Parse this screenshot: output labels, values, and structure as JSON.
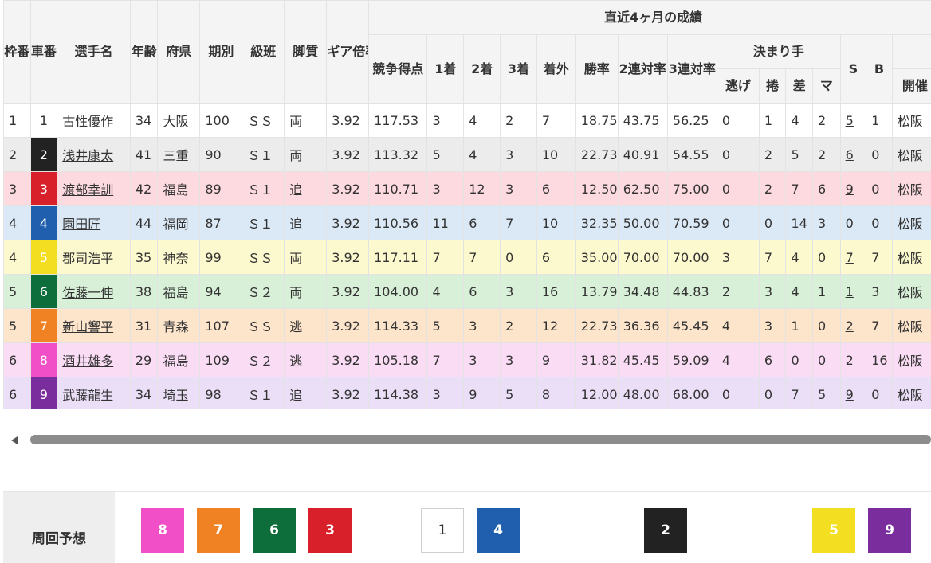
{
  "header": {
    "waku": "枠番",
    "sha": "車番",
    "name": "選手名",
    "age": "年齢",
    "pref": "府県",
    "term": "期別",
    "class": "級班",
    "style": "脚質",
    "gear": "ギア倍率",
    "recent": "直近4ヶ月の成績",
    "score": "競争得点",
    "first": "1着",
    "second": "2着",
    "third": "3着",
    "out": "着外",
    "winrate": "勝率",
    "quinella": "2連対率",
    "trio": "3連対率",
    "kimarite": "決まり手",
    "nige": "逃げ",
    "makuri": "捲",
    "sashi": "差",
    "mark": "マ",
    "s": "S",
    "b": "B",
    "venue": "開催"
  },
  "rows": [
    {
      "waku": "1",
      "car": "1",
      "name": "古性優作",
      "age": "34",
      "pref": "大阪",
      "term": "100",
      "class": "ＳＳ",
      "style": "両",
      "gear": "3.92",
      "score": "117.53",
      "w1": "3",
      "w2": "4",
      "w3": "2",
      "out": "7",
      "winrate": "18.75",
      "quinella": "43.75",
      "trio": "56.25",
      "nige": "0",
      "makuri": "1",
      "sashi": "4",
      "mark": "2",
      "s": "5",
      "b": "1",
      "venue": "松阪"
    },
    {
      "waku": "2",
      "car": "2",
      "name": "浅井康太",
      "age": "41",
      "pref": "三重",
      "term": "90",
      "class": "Ｓ１",
      "style": "両",
      "gear": "3.92",
      "score": "113.32",
      "w1": "5",
      "w2": "4",
      "w3": "3",
      "out": "10",
      "winrate": "22.73",
      "quinella": "40.91",
      "trio": "54.55",
      "nige": "0",
      "makuri": "2",
      "sashi": "5",
      "mark": "2",
      "s": "6",
      "b": "0",
      "venue": "松阪"
    },
    {
      "waku": "3",
      "car": "3",
      "name": "渡部幸訓",
      "age": "42",
      "pref": "福島",
      "term": "89",
      "class": "Ｓ１",
      "style": "追",
      "gear": "3.92",
      "score": "110.71",
      "w1": "3",
      "w2": "12",
      "w3": "3",
      "out": "6",
      "winrate": "12.50",
      "quinella": "62.50",
      "trio": "75.00",
      "nige": "0",
      "makuri": "2",
      "sashi": "7",
      "mark": "6",
      "s": "9",
      "b": "0",
      "venue": "松阪"
    },
    {
      "waku": "4",
      "car": "4",
      "name": "園田匠",
      "age": "44",
      "pref": "福岡",
      "term": "87",
      "class": "Ｓ１",
      "style": "追",
      "gear": "3.92",
      "score": "110.56",
      "w1": "11",
      "w2": "6",
      "w3": "7",
      "out": "10",
      "winrate": "32.35",
      "quinella": "50.00",
      "trio": "70.59",
      "nige": "0",
      "makuri": "0",
      "sashi": "14",
      "mark": "3",
      "s": "0",
      "b": "0",
      "venue": "松阪"
    },
    {
      "waku": "4",
      "car": "5",
      "name": "郡司浩平",
      "age": "35",
      "pref": "神奈",
      "term": "99",
      "class": "ＳＳ",
      "style": "両",
      "gear": "3.92",
      "score": "117.11",
      "w1": "7",
      "w2": "7",
      "w3": "0",
      "out": "6",
      "winrate": "35.00",
      "quinella": "70.00",
      "trio": "70.00",
      "nige": "3",
      "makuri": "7",
      "sashi": "4",
      "mark": "0",
      "s": "7",
      "b": "7",
      "venue": "松阪"
    },
    {
      "waku": "5",
      "car": "6",
      "name": "佐藤一伸",
      "age": "38",
      "pref": "福島",
      "term": "94",
      "class": "Ｓ２",
      "style": "両",
      "gear": "3.92",
      "score": "104.00",
      "w1": "4",
      "w2": "6",
      "w3": "3",
      "out": "16",
      "winrate": "13.79",
      "quinella": "34.48",
      "trio": "44.83",
      "nige": "2",
      "makuri": "3",
      "sashi": "4",
      "mark": "1",
      "s": "1",
      "b": "3",
      "venue": "松阪"
    },
    {
      "waku": "5",
      "car": "7",
      "name": "新山響平",
      "age": "31",
      "pref": "青森",
      "term": "107",
      "class": "ＳＳ",
      "style": "逃",
      "gear": "3.92",
      "score": "114.33",
      "w1": "5",
      "w2": "3",
      "w3": "2",
      "out": "12",
      "winrate": "22.73",
      "quinella": "36.36",
      "trio": "45.45",
      "nige": "4",
      "makuri": "3",
      "sashi": "1",
      "mark": "0",
      "s": "2",
      "b": "7",
      "venue": "松阪"
    },
    {
      "waku": "6",
      "car": "8",
      "name": "酒井雄多",
      "age": "29",
      "pref": "福島",
      "term": "109",
      "class": "Ｓ２",
      "style": "逃",
      "gear": "3.92",
      "score": "105.18",
      "w1": "7",
      "w2": "3",
      "w3": "3",
      "out": "9",
      "winrate": "31.82",
      "quinella": "45.45",
      "trio": "59.09",
      "nige": "4",
      "makuri": "6",
      "sashi": "0",
      "mark": "0",
      "s": "2",
      "b": "16",
      "venue": "松阪"
    },
    {
      "waku": "6",
      "car": "9",
      "name": "武藤龍生",
      "age": "34",
      "pref": "埼玉",
      "term": "98",
      "class": "Ｓ１",
      "style": "追",
      "gear": "3.92",
      "score": "114.38",
      "w1": "3",
      "w2": "9",
      "w3": "5",
      "out": "8",
      "winrate": "12.00",
      "quinella": "48.00",
      "trio": "68.00",
      "nige": "0",
      "makuri": "0",
      "sashi": "7",
      "mark": "5",
      "s": "9",
      "b": "0",
      "venue": "松阪"
    }
  ],
  "car_colors": {
    "1": {
      "bg": "#ffffff",
      "fg": "#333333"
    },
    "2": {
      "bg": "#222222",
      "fg": "#ffffff"
    },
    "3": {
      "bg": "#d7202a",
      "fg": "#ffffff"
    },
    "4": {
      "bg": "#1f5fae",
      "fg": "#ffffff"
    },
    "5": {
      "bg": "#f3de22",
      "fg": "#ffffff"
    },
    "6": {
      "bg": "#0e6e3b",
      "fg": "#ffffff"
    },
    "7": {
      "bg": "#f08224",
      "fg": "#ffffff"
    },
    "8": {
      "bg": "#f04fc8",
      "fg": "#ffffff"
    },
    "9": {
      "bg": "#7a2e9e",
      "fg": "#ffffff"
    }
  },
  "lap": {
    "label": "周回予想",
    "chips": [
      "8",
      "7",
      "6",
      "3",
      "1",
      "4",
      "2",
      "5",
      "9"
    ]
  }
}
